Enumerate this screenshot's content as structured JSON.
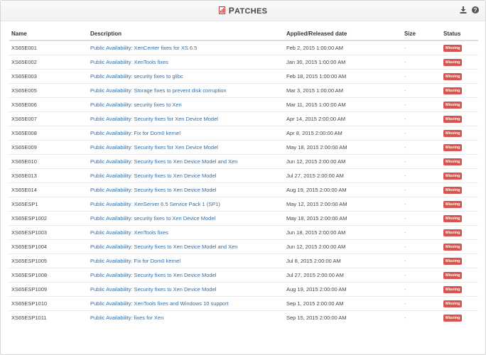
{
  "header": {
    "title_initial": "P",
    "title_rest": "ATCHES"
  },
  "columns": [
    "Name",
    "Description",
    "Applied/Released date",
    "Size",
    "Status"
  ],
  "status_color": "#d9534f",
  "link_color": "#2b6fad",
  "patches": [
    {
      "name": "XS65E001",
      "description": "Public Availability: XenCenter fixes for XS 6.5",
      "date": "Feb 2, 2015 1:00:00 AM",
      "size": "-",
      "status": "Missing"
    },
    {
      "name": "XS65E002",
      "description": "Public Availability: XenTools fixes",
      "date": "Jan 30, 2015 1:00:00 AM",
      "size": "-",
      "status": "Missing"
    },
    {
      "name": "XS65E003",
      "description": "Public Availability: security fixes to glibc",
      "date": "Feb 18, 2015 1:00:00 AM",
      "size": "-",
      "status": "Missing"
    },
    {
      "name": "XS65E005",
      "description": "Public Availability: Storage fixes to prevent disk corruption",
      "date": "Mar 3, 2015 1:00:00 AM",
      "size": "-",
      "status": "Missing"
    },
    {
      "name": "XS65E006",
      "description": "Public Availability: security fixes to Xen",
      "date": "Mar 11, 2015 1:00:00 AM",
      "size": "-",
      "status": "Missing"
    },
    {
      "name": "XS65E007",
      "description": "Public Availability: Security fixes for Xen Device Model",
      "date": "Apr 14, 2015 2:00:00 AM",
      "size": "-",
      "status": "Missing"
    },
    {
      "name": "XS65E008",
      "description": "Public Availability: Fix for Dom0 kernel",
      "date": "Apr 8, 2015 2:00:00 AM",
      "size": "-",
      "status": "Missing"
    },
    {
      "name": "XS65E009",
      "description": "Public Availability: Security fixes for Xen Device Model",
      "date": "May 18, 2015 2:00:00 AM",
      "size": "-",
      "status": "Missing"
    },
    {
      "name": "XS65E010",
      "description": "Public Availability: Security fixes to Xen Device Model and Xen",
      "date": "Jun 12, 2015 2:00:00 AM",
      "size": "-",
      "status": "Missing"
    },
    {
      "name": "XS65E013",
      "description": "Public Availability: Security fixes to Xen Device Model",
      "date": "Jul 27, 2015 2:00:00 AM",
      "size": "-",
      "status": "Missing"
    },
    {
      "name": "XS65E014",
      "description": "Public Availability: Security fixes to Xen Device Model",
      "date": "Aug 19, 2015 2:00:00 AM",
      "size": "-",
      "status": "Missing"
    },
    {
      "name": "XS65ESP1",
      "description": "Public Availability: XenServer 6.5 Service Pack 1 (SP1)",
      "date": "May 12, 2015 2:00:00 AM",
      "size": "-",
      "status": "Missing"
    },
    {
      "name": "XS65ESP1002",
      "description": "Public Availability: security fixes to Xen Device Model",
      "date": "May 18, 2015 2:00:00 AM",
      "size": "-",
      "status": "Missing"
    },
    {
      "name": "XS65ESP1003",
      "description": "Public Availability: XenTools fixes",
      "date": "Jun 18, 2015 2:00:00 AM",
      "size": "-",
      "status": "Missing"
    },
    {
      "name": "XS65ESP1004",
      "description": "Public Availability: Security fixes to Xen Device Model and Xen",
      "date": "Jun 12, 2015 2:00:00 AM",
      "size": "-",
      "status": "Missing"
    },
    {
      "name": "XS65ESP1005",
      "description": "Public Availability: Fix for Dom0 kernel",
      "date": "Jul 8, 2015 2:00:00 AM",
      "size": "-",
      "status": "Missing"
    },
    {
      "name": "XS65ESP1008",
      "description": "Public Availability: Security fixes to Xen Device Model",
      "date": "Jul 27, 2015 2:00:00 AM",
      "size": "-",
      "status": "Missing"
    },
    {
      "name": "XS65ESP1009",
      "description": "Public Availability: Security fixes to Xen Device Model",
      "date": "Aug 19, 2015 2:00:00 AM",
      "size": "-",
      "status": "Missing"
    },
    {
      "name": "XS65ESP1010",
      "description": "Public Availability: XenTools fixes and Windows 10 support",
      "date": "Sep 1, 2015 2:00:00 AM",
      "size": "-",
      "status": "Missing"
    },
    {
      "name": "XS65ESP1011",
      "description": "Public Availability: fixes for Xen",
      "date": "Sep 15, 2015 2:00:00 AM",
      "size": "-",
      "status": "Missing"
    }
  ],
  "icons": {
    "title": "patch-list-icon",
    "download": "download-icon",
    "help": "help-icon"
  }
}
